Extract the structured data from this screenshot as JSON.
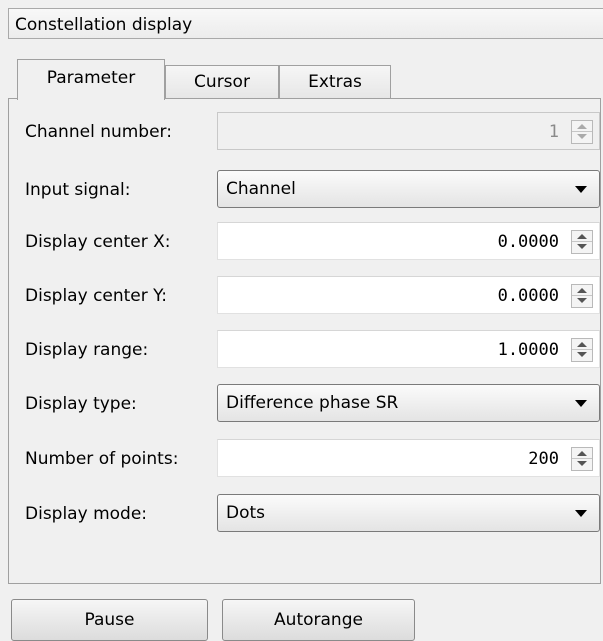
{
  "window": {
    "title": "Constellation display"
  },
  "tabs": [
    {
      "label": "Parameter",
      "active": true
    },
    {
      "label": "Cursor",
      "active": false
    },
    {
      "label": "Extras",
      "active": false
    }
  ],
  "parameters": {
    "channel_number": {
      "label": "Channel number:",
      "value": "1",
      "enabled": false
    },
    "input_signal": {
      "label": "Input signal:",
      "value": "Channel"
    },
    "display_center_x": {
      "label": "Display center X:",
      "value": "0.0000"
    },
    "display_center_y": {
      "label": "Display center Y:",
      "value": "0.0000"
    },
    "display_range": {
      "label": "Display range:",
      "value": "1.0000"
    },
    "display_type": {
      "label": "Display type:",
      "value": "Difference phase SR"
    },
    "number_of_points": {
      "label": "Number of points:",
      "value": "200"
    },
    "display_mode": {
      "label": "Display mode:",
      "value": "Dots"
    }
  },
  "buttons": {
    "pause": "Pause",
    "autorange": "Autorange"
  }
}
